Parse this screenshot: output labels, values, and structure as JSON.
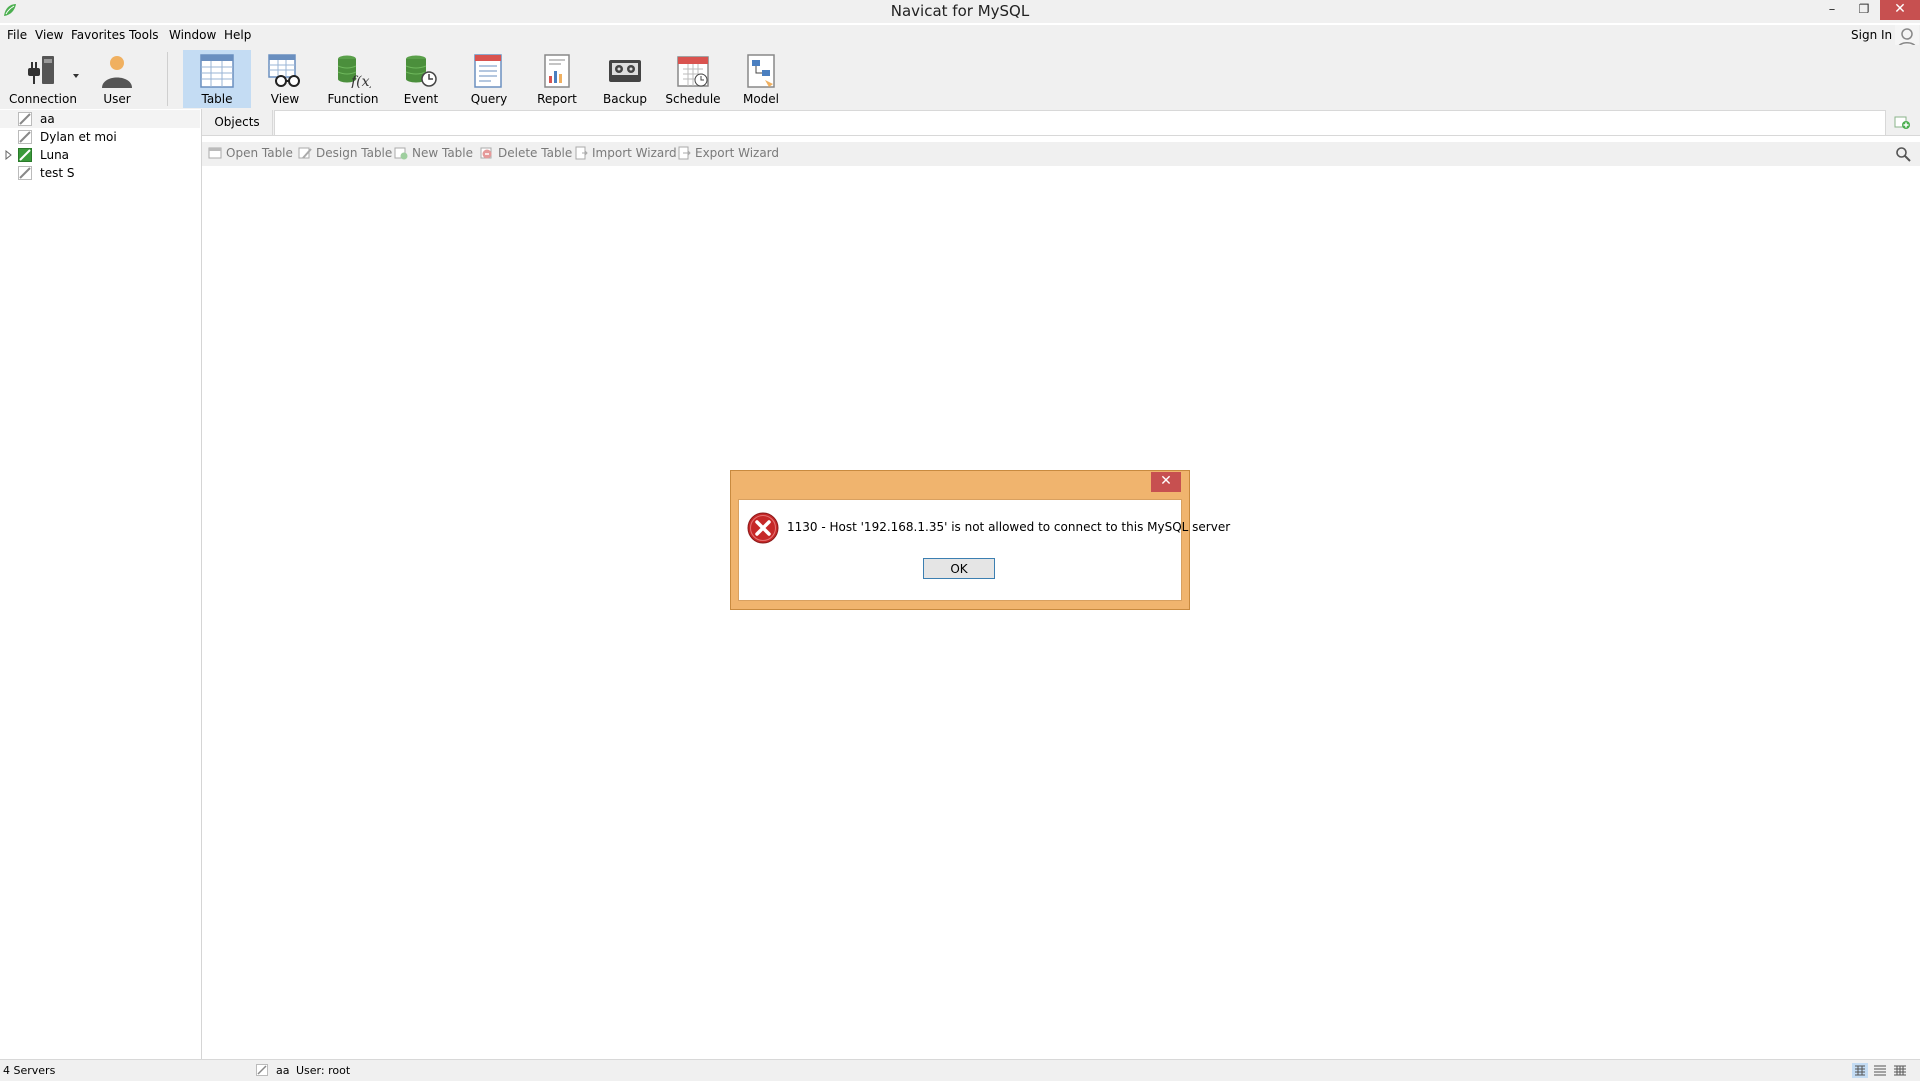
{
  "window": {
    "title": "Navicat for MySQL"
  },
  "menu": [
    "File",
    "View",
    "Favorites",
    "Tools",
    "Window",
    "Help"
  ],
  "account": {
    "sign_in": "Sign In"
  },
  "toolbar": [
    {
      "label": "Connection",
      "icon": "connection-icon"
    },
    {
      "label": "User",
      "icon": "user-icon"
    },
    {
      "label": "Table",
      "icon": "table-icon",
      "active": true
    },
    {
      "label": "View",
      "icon": "view-icon"
    },
    {
      "label": "Function",
      "icon": "function-icon"
    },
    {
      "label": "Event",
      "icon": "event-icon"
    },
    {
      "label": "Query",
      "icon": "query-icon"
    },
    {
      "label": "Report",
      "icon": "report-icon"
    },
    {
      "label": "Backup",
      "icon": "backup-icon"
    },
    {
      "label": "Schedule",
      "icon": "schedule-icon"
    },
    {
      "label": "Model",
      "icon": "model-icon"
    }
  ],
  "connections": [
    {
      "label": "aa",
      "selected": true
    },
    {
      "label": "Dylan et moi"
    },
    {
      "label": "Luna",
      "expandable": true,
      "connected": true
    },
    {
      "label": "test S"
    }
  ],
  "tabs": {
    "objects": "Objects"
  },
  "object_toolbar": [
    "Open Table",
    "Design Table",
    "New Table",
    "Delete Table",
    "Import Wizard",
    "Export Wizard"
  ],
  "status": {
    "servers": "4 Servers",
    "connection": "aa",
    "user": "User: root"
  },
  "dialog": {
    "message": "1130 - Host '192.168.1.35' is not allowed to connect to this MySQL server",
    "ok": "OK"
  },
  "colors": {
    "dialog_frame": "#f0b46e",
    "close_red": "#c75050",
    "active_tool": "#c4dcf3"
  }
}
